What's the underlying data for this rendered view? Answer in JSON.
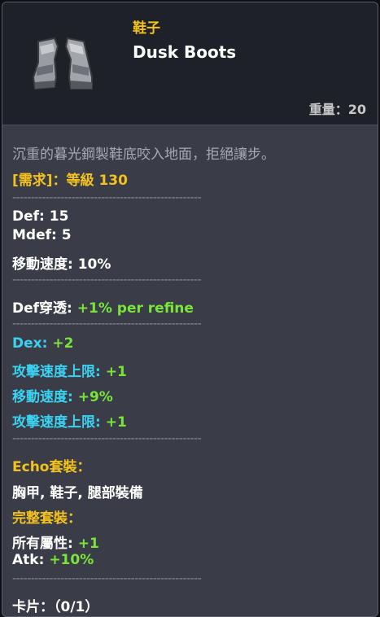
{
  "item": {
    "type_label": "鞋子",
    "name": "Dusk Boots",
    "weight_label": "重量：",
    "weight_value": "20",
    "icon": "boots-icon"
  },
  "description": "沉重的暮光鋼製鞋底咬入地面，拒絕讓步。",
  "requirement": "[需求]：等級 130",
  "divider": "---------------------------------------------------",
  "base_stats": [
    {
      "label": "Def: ",
      "value": "15"
    },
    {
      "label": "Mdef: ",
      "value": "5"
    },
    {
      "label": "移動速度: ",
      "value": "10%"
    }
  ],
  "refine": {
    "label": "Def穿透: ",
    "value": "+1% per refine"
  },
  "bonuses": [
    {
      "label": "Dex: ",
      "value": "+2"
    },
    {
      "label": "攻擊速度上限: ",
      "value": "+1"
    },
    {
      "label": "移動速度: ",
      "value": "+9%"
    },
    {
      "label": "攻擊速度上限: ",
      "value": "+1"
    }
  ],
  "set": {
    "title": "Echo套裝：",
    "pieces": "胸甲, 鞋子, 腿部裝備",
    "complete_title": "完整套裝：",
    "complete_bonuses": [
      {
        "label": "所有屬性: ",
        "value": "+1"
      },
      {
        "label": "Atk: ",
        "value": "+10%"
      }
    ]
  },
  "cards": "卡片：（0/1）",
  "colors": {
    "yellow": "#f4c21c",
    "cyan": "#3ad2f2",
    "green": "#79e53a",
    "panel": "#3a3d47",
    "header": "#1f2128"
  }
}
